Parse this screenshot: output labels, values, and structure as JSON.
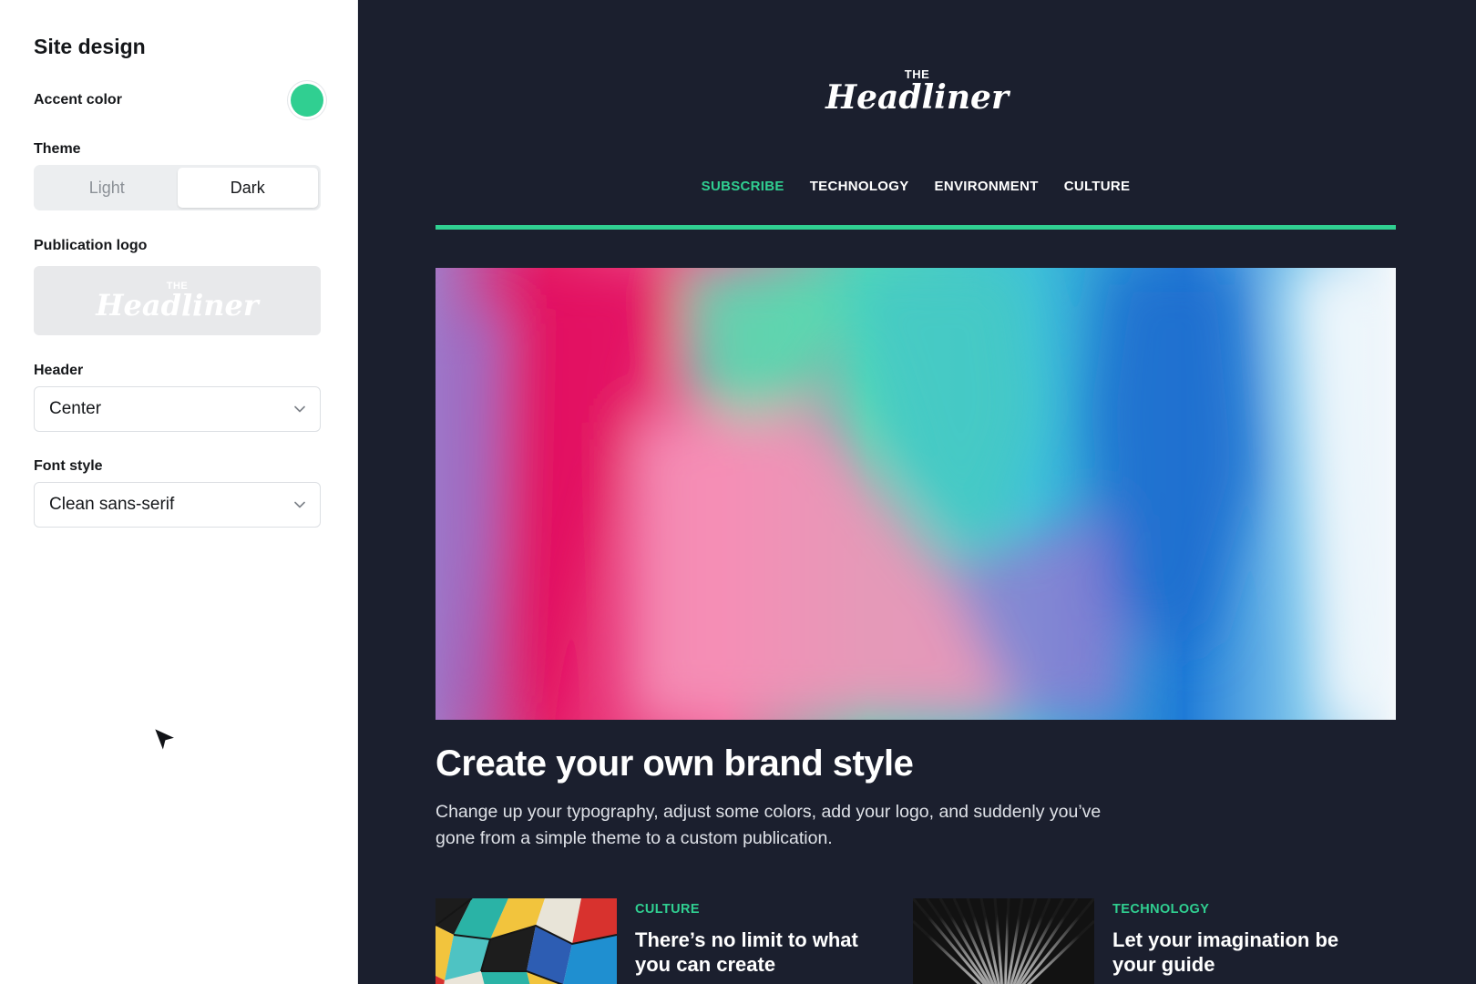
{
  "colors": {
    "accent": "#30cf91",
    "preview_bg": "#1b1f2e",
    "sidebar_bg": "#ffffff"
  },
  "sidebar": {
    "title": "Site design",
    "accent_color_label": "Accent color",
    "theme_label": "Theme",
    "theme_options": [
      "Light",
      "Dark"
    ],
    "theme_selected": "Dark",
    "publication_logo_label": "Publication logo",
    "logo_preview": {
      "the": "THE",
      "name": "Headliner"
    },
    "header_label": "Header",
    "header_value": "Center",
    "font_style_label": "Font style",
    "font_style_value": "Clean sans-serif"
  },
  "preview": {
    "logo": {
      "the": "THE",
      "name": "Headliner"
    },
    "nav": [
      "SUBSCRIBE",
      "TECHNOLOGY",
      "ENVIRONMENT",
      "CULTURE"
    ],
    "headline": "Create your own brand style",
    "excerpt": "Change up your typography, adjust some colors, add your logo, and suddenly you’ve gone from a simple theme to a custom publication.",
    "cards": [
      {
        "category": "CULTURE",
        "title": "There’s no limit to what you can create"
      },
      {
        "category": "TECHNOLOGY",
        "title": "Let your imagination be your guide"
      }
    ]
  },
  "icons": {
    "select_chevron": "chevron-down-icon",
    "pointer": "cursor-arrow-icon"
  }
}
